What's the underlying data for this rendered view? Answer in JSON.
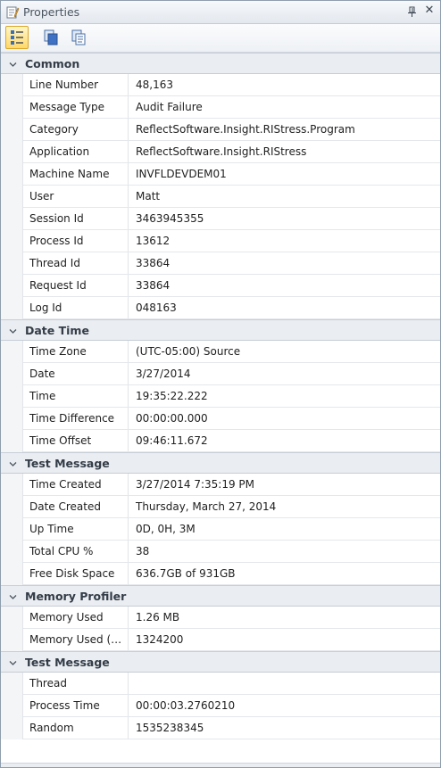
{
  "window": {
    "title": "Properties"
  },
  "icons": {
    "title": "properties-icon",
    "pin": "pin-icon",
    "close": "close-icon",
    "tool_categorized": "categorized-icon",
    "tool_copy": "copy-icon",
    "tool_copy_all": "copy-all-icon",
    "expander": "chevron-down-icon"
  },
  "colors": {
    "category_bg": "#eaedf1",
    "active_tool": "#ffd86a",
    "border": "#8f9ead"
  },
  "categories": [
    {
      "label": "Common",
      "rows": [
        {
          "name": "Line Number",
          "value": "48,163"
        },
        {
          "name": "Message Type",
          "value": "Audit Failure"
        },
        {
          "name": "Category",
          "value": "ReflectSoftware.Insight.RIStress.Program"
        },
        {
          "name": "Application",
          "value": "ReflectSoftware.Insight.RIStress"
        },
        {
          "name": "Machine Name",
          "value": "INVFLDEVDEM01"
        },
        {
          "name": "User",
          "value": "Matt"
        },
        {
          "name": "Session Id",
          "value": "3463945355"
        },
        {
          "name": "Process Id",
          "value": "13612"
        },
        {
          "name": "Thread Id",
          "value": "33864"
        },
        {
          "name": "Request Id",
          "value": "33864"
        },
        {
          "name": "Log Id",
          "value": "048163"
        }
      ]
    },
    {
      "label": "Date Time",
      "rows": [
        {
          "name": "Time Zone",
          "value": "(UTC-05:00) Source"
        },
        {
          "name": "Date",
          "value": "3/27/2014"
        },
        {
          "name": "Time",
          "value": "19:35:22.222"
        },
        {
          "name": "Time Difference",
          "value": "00:00:00.000"
        },
        {
          "name": "Time Offset",
          "value": "09:46:11.672"
        }
      ]
    },
    {
      "label": "Test Message",
      "rows": [
        {
          "name": "Time Created",
          "value": "3/27/2014 7:35:19 PM"
        },
        {
          "name": "Date Created",
          "value": "Thursday, March 27, 2014"
        },
        {
          "name": "Up Time",
          "value": "0D, 0H, 3M"
        },
        {
          "name": "Total CPU %",
          "value": "38"
        },
        {
          "name": "Free Disk Space",
          "value": "636.7GB of 931GB"
        }
      ]
    },
    {
      "label": "Memory Profiler",
      "rows": [
        {
          "name": "Memory Used",
          "value": "1.26 MB"
        },
        {
          "name": "Memory Used (Raw)",
          "value": "1324200"
        }
      ]
    },
    {
      "label": "Test Message",
      "rows": [
        {
          "name": "Thread",
          "value": ""
        },
        {
          "name": "Process Time",
          "value": "00:00:03.2760210"
        },
        {
          "name": "Random",
          "value": "1535238345"
        }
      ]
    }
  ]
}
